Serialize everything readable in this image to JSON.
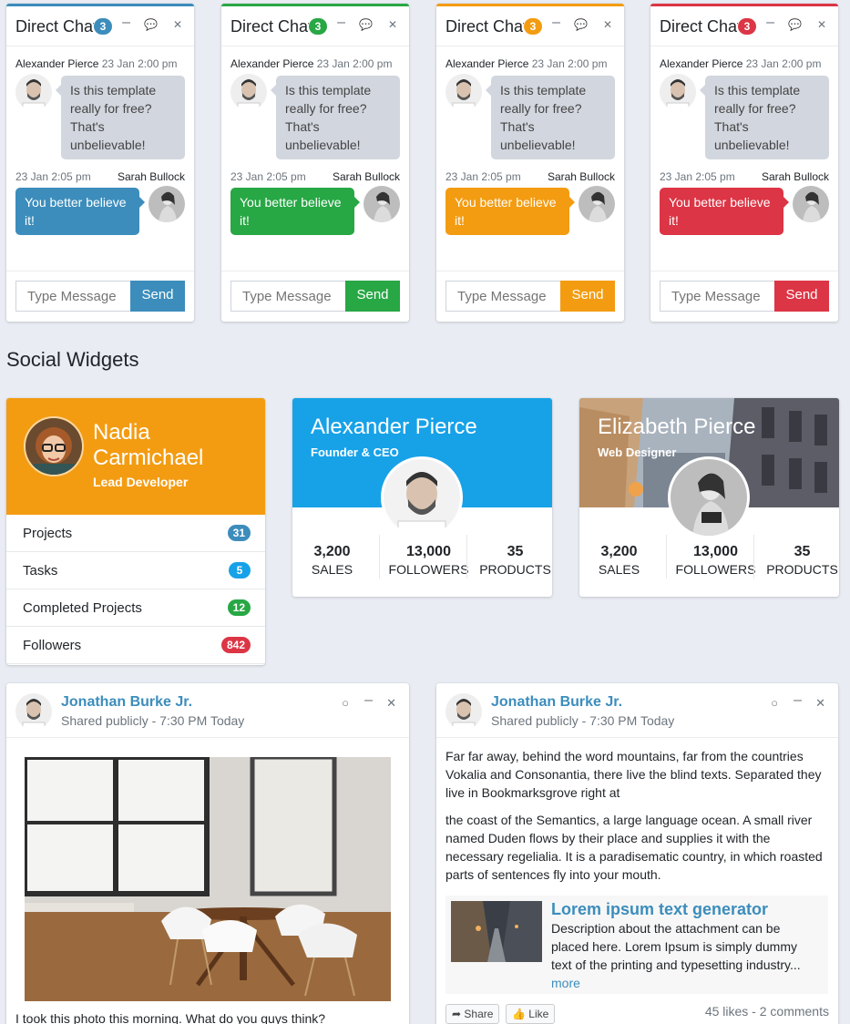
{
  "chats": [
    {
      "title": "Direct Chat",
      "badge": "3",
      "color": "#3c8dbc",
      "left_msg": {
        "name": "Alexander Pierce",
        "time": "23 Jan 2:00 pm",
        "text": "Is this template really for free? That's unbelievable!"
      },
      "right_msg": {
        "name": "Sarah Bullock",
        "time": "23 Jan 2:05 pm",
        "text": "You better believe it!"
      },
      "input_placeholder": "Type Message",
      "send_label": "Send"
    },
    {
      "title": "Direct Chat",
      "badge": "3",
      "color": "#28a745",
      "left_msg": {
        "name": "Alexander Pierce",
        "time": "23 Jan 2:00 pm",
        "text": "Is this template really for free? That's unbelievable!"
      },
      "right_msg": {
        "name": "Sarah Bullock",
        "time": "23 Jan 2:05 pm",
        "text": "You better believe it!"
      },
      "input_placeholder": "Type Message",
      "send_label": "Send"
    },
    {
      "title": "Direct Chat",
      "badge": "3",
      "color": "#f39c12",
      "left_msg": {
        "name": "Alexander Pierce",
        "time": "23 Jan 2:00 pm",
        "text": "Is this template really for free? That's unbelievable!"
      },
      "right_msg": {
        "name": "Sarah Bullock",
        "time": "23 Jan 2:05 pm",
        "text": "You better believe it!"
      },
      "input_placeholder": "Type Message",
      "send_label": "Send"
    },
    {
      "title": "Direct Chat",
      "badge": "3",
      "color": "#dc3545",
      "left_msg": {
        "name": "Alexander Pierce",
        "time": "23 Jan 2:00 pm",
        "text": "Is this template really for free? That's unbelievable!"
      },
      "right_msg": {
        "name": "Sarah Bullock",
        "time": "23 Jan 2:05 pm",
        "text": "You better believe it!"
      },
      "input_placeholder": "Type Message",
      "send_label": "Send"
    }
  ],
  "section_title": "Social Widgets",
  "widget1": {
    "name": "Nadia Carmichael",
    "desc": "Lead Developer",
    "color": "#f39c12",
    "rows": [
      {
        "label": "Projects",
        "count": "31",
        "color": "#3c8dbc"
      },
      {
        "label": "Tasks",
        "count": "5",
        "color": "#17a2e8"
      },
      {
        "label": "Completed Projects",
        "count": "12",
        "color": "#28a745"
      },
      {
        "label": "Followers",
        "count": "842",
        "color": "#dc3545"
      }
    ]
  },
  "widget2": {
    "name": "Alexander Pierce",
    "desc": "Founder & CEO",
    "color": "#17a2e8",
    "stats": [
      {
        "value": "3,200",
        "label": "SALES"
      },
      {
        "value": "13,000",
        "label": "FOLLOWERS"
      },
      {
        "value": "35",
        "label": "PRODUCTS"
      }
    ]
  },
  "widget3": {
    "name": "Elizabeth Pierce",
    "desc": "Web Designer",
    "stats": [
      {
        "value": "3,200",
        "label": "SALES"
      },
      {
        "value": "13,000",
        "label": "FOLLOWERS"
      },
      {
        "value": "35",
        "label": "PRODUCTS"
      }
    ]
  },
  "post1": {
    "user": "Jonathan Burke Jr.",
    "sub": "Shared publicly - 7:30 PM Today",
    "caption": "I took this photo this morning. What do you guys think?"
  },
  "post2": {
    "user": "Jonathan Burke Jr.",
    "sub": "Shared publicly - 7:30 PM Today",
    "para1": "Far far away, behind the word mountains, far from the countries Vokalia and Consonantia, there live the blind texts. Separated they live in Bookmarksgrove right at",
    "para2": "the coast of the Semantics, a large language ocean. A small river named Duden flows by their place and supplies it with the necessary regelialia. It is a paradisematic country, in which roasted parts of sentences fly into your mouth.",
    "attach_title": "Lorem ipsum text generator",
    "attach_desc": "Description about the attachment can be placed here. Lorem Ipsum is simply dummy text of the printing and typesetting industry...",
    "attach_more": "more",
    "share_label": "Share",
    "like_label": "Like",
    "meta": "45 likes - 2 comments"
  }
}
